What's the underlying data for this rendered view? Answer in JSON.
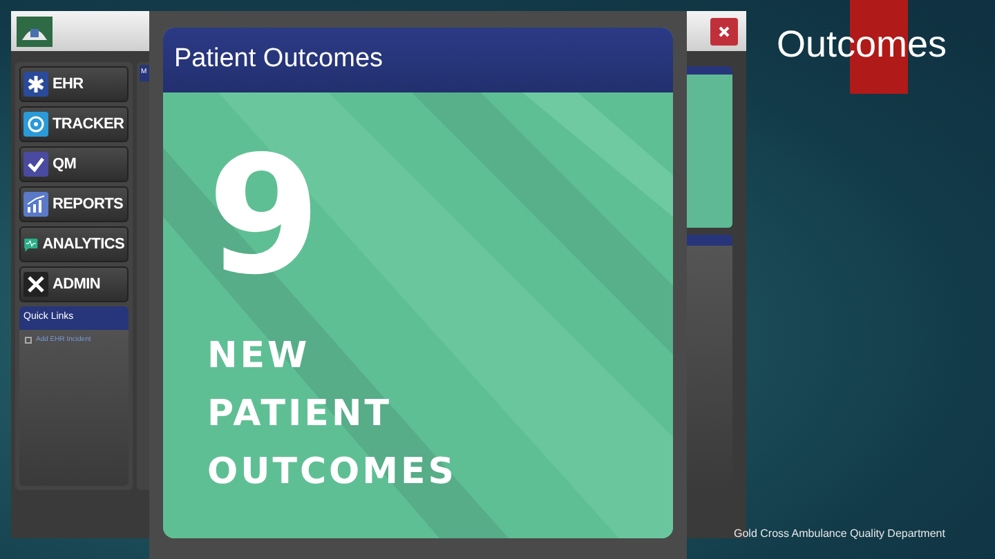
{
  "slide": {
    "title": "Outcomes",
    "footer": "Gold Cross Ambulance Quality Department"
  },
  "app": {
    "nav": [
      {
        "label": "EHR",
        "kind": "ehr"
      },
      {
        "label": "TRACKER",
        "kind": "tracker"
      },
      {
        "label": "QM",
        "kind": "qm"
      },
      {
        "label": "REPORTS",
        "kind": "reports"
      },
      {
        "label": "ANALYTICS",
        "kind": "analytics"
      },
      {
        "label": "ADMIN",
        "kind": "admin"
      }
    ],
    "quick_links": {
      "title": "Quick Links",
      "items": [
        {
          "label": "Add EHR Incident",
          "checked": false
        }
      ]
    },
    "main_tab": {
      "title": "M"
    }
  },
  "popup": {
    "title": "Patient Outcomes",
    "count": "9",
    "caption": "NEW PATIENT OUTCOMES"
  }
}
